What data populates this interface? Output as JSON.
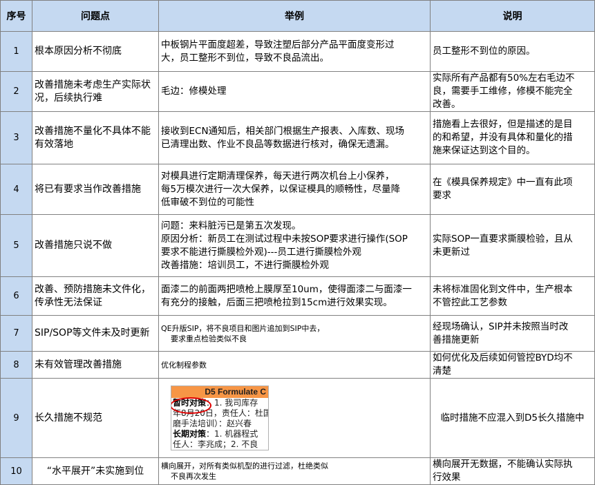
{
  "headers": {
    "no": "序号",
    "issue": "问题点",
    "example": "举例",
    "desc": "说明"
  },
  "rows": [
    {
      "no": "1",
      "issue": "根本原因分析不彻底",
      "example": [
        "中板钢片平面度超差，导致注塑后部分产品平面度变形过",
        "大，员工整形不到位，导致不良品流出。"
      ],
      "desc": [
        "员工整形不到位的原因。"
      ]
    },
    {
      "no": "2",
      "issue": "改善措施未考虑生产实际状况，后续执行难",
      "example": [
        "毛边：修模处理"
      ],
      "desc": [
        "实际所有产品都有50%左右毛边不",
        "良，需要手工维修，修模不能完全",
        "改善。"
      ]
    },
    {
      "no": "3",
      "issue": "改善措施不量化不具体不能有效落地",
      "example": [
        "接收到ECN通知后，相关部门根据生产报表、入库数、现场",
        "已清理出数、作业不良品等数据进行核对，确保无遗漏。"
      ],
      "desc": [
        "措施看上去很好，但是描述的是目",
        "的和希望，并没有具体和量化的措",
        "施来保证达到这个目的。"
      ]
    },
    {
      "no": "4",
      "issue": "将已有要求当作改善措施",
      "example": [
        "对模具进行定期清理保养，每天进行两次机台上小保养，",
        "每5万模次进行一次大保养，以保证模具的顺畅性，尽量降",
        "低审破不到位的可能性"
      ],
      "desc": [
        "在《模具保养规定》中一直有此项",
        "要求"
      ]
    },
    {
      "no": "5",
      "issue": "改善措施只说不做",
      "example": [
        "问题：来料脏污已是第五次发现。",
        "原因分析：新员工在测试过程中未按SOP要求进行操作(SOP",
        "要求不能进行撕膜检外观)---员工进行撕膜检外观",
        "改善措施：培训员工，不进行撕膜检外观"
      ],
      "desc": [
        "实际SOP一直要求撕膜检验，且从",
        "未更新过"
      ]
    },
    {
      "no": "6",
      "issue": "改善、预防措施未文件化，传承性无法保证",
      "example": [
        "面漆二的前面两把喷枪上膜厚至10um，使得面漆二与面漆一",
        "有充分的接触，后面三把喷枪拉到15cm进行效果实现。"
      ],
      "desc": [
        "未将标准固化到文件中，生产根本",
        "不管控此工艺参数"
      ]
    },
    {
      "no": "7",
      "issue": "SIP/SOP等文件未及时更新",
      "example": [
        "QE升版SIP，将不良项目和图片追加到SIP中去，",
        "要求重点检验类似不良"
      ],
      "desc": [
        "经现场确认，SIP并未按照当时改",
        "善措施更新"
      ]
    },
    {
      "no": "8",
      "issue": "未有效管理改善措施",
      "example": [
        "优化制程参数"
      ],
      "desc": [
        "如何优化及后续如何管控BYD均不",
        "清楚"
      ]
    },
    {
      "no": "9",
      "issue": "长久措施不规范",
      "image": {
        "header": "D5 Formulate C",
        "lines": [
          {
            "bold": "暂时对策",
            "text": "：1. 我司库存"
          },
          {
            "bold": "",
            "text": "年8月20日，责任人：杜国"
          },
          {
            "bold": "",
            "text": "磨手法培训）：赵兴春"
          },
          {
            "bold": "长期对策",
            "text": "：1. 机器程式"
          },
          {
            "bold": "",
            "text": "任人：李兆成；2. 不良"
          }
        ]
      },
      "desc": [
        "临时措施不应混入到D5长久措施中"
      ]
    },
    {
      "no": "10",
      "issue": "“水平展开”未实施到位",
      "example": [
        "横向展开，对所有类似机型的进行过滤，杜绝类似",
        "不良再次发生"
      ],
      "desc": [
        "横向展开无数据，不能确认实际执",
        "行效果"
      ]
    }
  ]
}
